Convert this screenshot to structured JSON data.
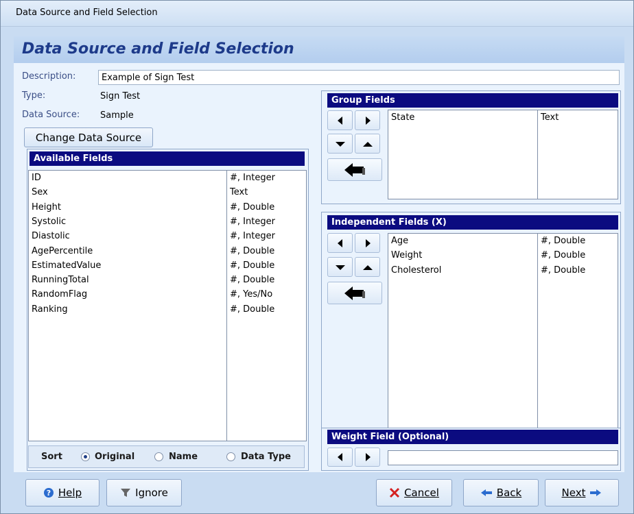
{
  "window": {
    "title": "Data Source and Field Selection"
  },
  "header": {
    "title": "Data Source and Field Selection"
  },
  "form": {
    "description_label": "Description:",
    "description_value": "Example of Sign Test",
    "type_label": "Type:",
    "type_value": "Sign Test",
    "datasource_label": "Data Source:",
    "datasource_value": "Sample",
    "change_button": "Change Data Source"
  },
  "available": {
    "title": "Available Fields",
    "rows": [
      {
        "name": "ID",
        "type": "#, Integer"
      },
      {
        "name": "Sex",
        "type": "Text"
      },
      {
        "name": "Height",
        "type": "#, Double"
      },
      {
        "name": "Systolic",
        "type": "#, Integer"
      },
      {
        "name": "Diastolic",
        "type": "#, Integer"
      },
      {
        "name": "AgePercentile",
        "type": "#, Double"
      },
      {
        "name": "EstimatedValue",
        "type": "#, Double"
      },
      {
        "name": "RunningTotal",
        "type": "#, Double"
      },
      {
        "name": "RandomFlag",
        "type": "#, Yes/No"
      },
      {
        "name": "Ranking",
        "type": "#, Double"
      }
    ]
  },
  "sort": {
    "label": "Sort",
    "options": [
      "Original",
      "Name",
      "Data Type"
    ],
    "selected": "Original"
  },
  "group": {
    "title": "Group Fields",
    "rows": [
      {
        "name": "State",
        "type": "Text"
      }
    ]
  },
  "independent": {
    "title": "Independent Fields (X)",
    "rows": [
      {
        "name": "Age",
        "type": "#, Double"
      },
      {
        "name": "Weight",
        "type": "#, Double"
      },
      {
        "name": "Cholesterol",
        "type": "#, Double"
      }
    ]
  },
  "weight": {
    "title": "Weight Field (Optional)",
    "value": ""
  },
  "footer": {
    "help": "Help",
    "ignore": "Ignore",
    "cancel": "Cancel",
    "back": "Back",
    "next": "Next"
  },
  "colors": {
    "panel_header": "#0b0b80",
    "title_text": "#1d3a8a",
    "cancel_icon": "#d42020",
    "arrow_icon": "#2b6ccf"
  }
}
